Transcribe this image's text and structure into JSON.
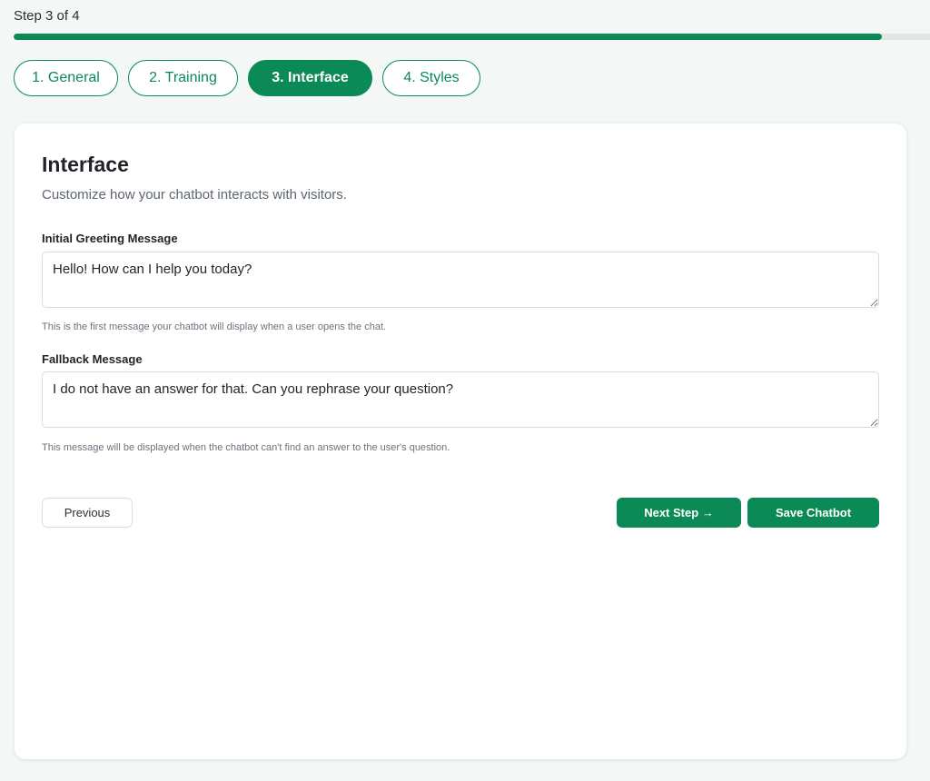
{
  "wizard": {
    "step_label": "Step 3 of 4",
    "progress_percent": 94.7
  },
  "tabs": [
    {
      "label": "1. General",
      "active": false
    },
    {
      "label": "2. Training",
      "active": false
    },
    {
      "label": "3. Interface",
      "active": true
    },
    {
      "label": "4. Styles",
      "active": false
    }
  ],
  "card": {
    "title": "Interface",
    "subtitle": "Customize how your chatbot interacts with visitors."
  },
  "greeting": {
    "label": "Initial Greeting Message",
    "value": "Hello! How can I help you today?",
    "hint": "This is the first message your chatbot will display when a user opens the chat."
  },
  "fallback": {
    "label": "Fallback Message",
    "value": "I do not have an answer for that. Can you rephrase your question?",
    "hint": "This message will be displayed when the chatbot can't find an answer to the user's question."
  },
  "actions": {
    "previous_label": "Previous",
    "next_label": "Next Step →",
    "save_label": "Save Chatbot"
  },
  "colors": {
    "accent": "#0b8a57",
    "background": "#f3f7f5"
  }
}
